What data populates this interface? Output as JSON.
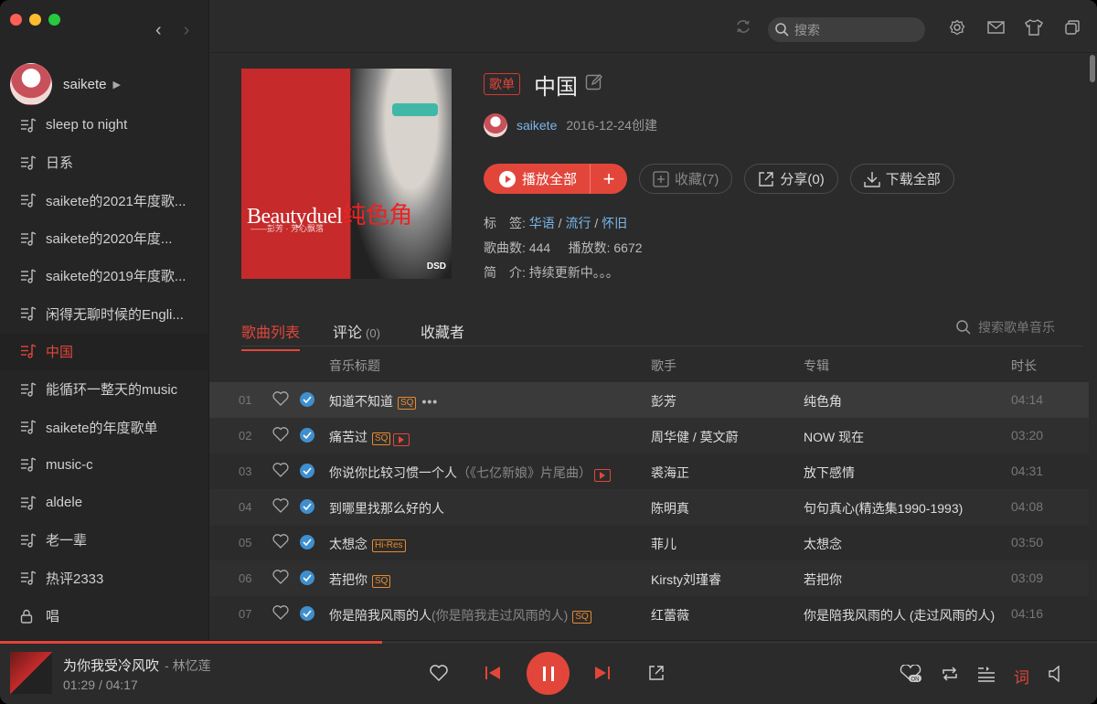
{
  "colors": {
    "accent": "#e2463b",
    "link": "#7ab6e8",
    "badge_orange": "#e58a30"
  },
  "topbar": {
    "search_placeholder": "搜索"
  },
  "sidebar": {
    "user": "saikete",
    "playlists": [
      {
        "label": "sleep to night",
        "icon": "playlist-icon"
      },
      {
        "label": "日系",
        "icon": "playlist-icon"
      },
      {
        "label": "saikete的2021年度歌...",
        "icon": "playlist-icon"
      },
      {
        "label": "saikete的2020年度...",
        "icon": "playlist-icon"
      },
      {
        "label": "saikete的2019年度歌...",
        "icon": "playlist-icon"
      },
      {
        "label": "闲得无聊时候的Engli...",
        "icon": "playlist-icon"
      },
      {
        "label": "中国",
        "icon": "playlist-icon",
        "active": true
      },
      {
        "label": "能循环一整天的music",
        "icon": "playlist-icon"
      },
      {
        "label": "saikete的年度歌单",
        "icon": "playlist-icon"
      },
      {
        "label": "music-c",
        "icon": "playlist-icon"
      },
      {
        "label": "aldele",
        "icon": "playlist-icon"
      },
      {
        "label": "老一辈",
        "icon": "playlist-icon"
      },
      {
        "label": "热评2333",
        "icon": "playlist-icon"
      },
      {
        "label": "唱",
        "icon": "lock-icon"
      }
    ]
  },
  "cover": {
    "title_en": "Beautyduel",
    "title_cn": "纯色角",
    "subtitle": "——彭芳 · 芳心飘落",
    "label": "DSD"
  },
  "playlist": {
    "tag": "歌单",
    "title": "中国",
    "creator": "saikete",
    "created": "2016-12-24创建",
    "buttons": {
      "play_all": "播放全部",
      "collect": "收藏(7)",
      "share": "分享(0)",
      "download": "下载全部"
    },
    "tags_label": "标　签:",
    "tags": [
      "华语",
      "流行",
      "怀旧"
    ],
    "song_count_label": "歌曲数:",
    "song_count": "444",
    "play_count_label": "播放数:",
    "play_count": "6672",
    "desc_label": "简　介:",
    "desc": "持续更新中。。。"
  },
  "tabs": {
    "songs": "歌曲列表",
    "comments": "评论",
    "comments_count": "(0)",
    "collectors": "收藏者",
    "search_placeholder": "搜索歌单音乐"
  },
  "columns": {
    "title": "音乐标题",
    "artist": "歌手",
    "album": "专辑",
    "duration": "时长"
  },
  "songs": [
    {
      "num": "01",
      "title": "知道不知道",
      "sub": "",
      "badges": [
        "SQ"
      ],
      "mv": false,
      "more": true,
      "artist": "彭芳",
      "album": "纯色角",
      "duration": "04:14"
    },
    {
      "num": "02",
      "title": "痛苦过",
      "sub": "",
      "badges": [
        "SQ"
      ],
      "mv": true,
      "artist": "周华健 / 莫文蔚",
      "album": "NOW 现在",
      "duration": "03:20"
    },
    {
      "num": "03",
      "title": "你说你比较习惯一个人",
      "sub": "（《七亿新娘》片尾曲）",
      "badges": [],
      "mv": true,
      "artist": "裘海正",
      "album": "放下感情",
      "duration": "04:31"
    },
    {
      "num": "04",
      "title": "到哪里找那么好的人",
      "sub": "",
      "badges": [],
      "mv": false,
      "artist": "陈明真",
      "album": "句句真心(精选集1990-1993)",
      "duration": "04:08"
    },
    {
      "num": "05",
      "title": "太想念",
      "sub": "",
      "badges": [
        "Hi-Res"
      ],
      "mv": false,
      "artist": "菲儿",
      "album": "太想念",
      "duration": "03:50"
    },
    {
      "num": "06",
      "title": "若把你",
      "sub": "",
      "badges": [
        "SQ"
      ],
      "mv": false,
      "artist": "Kirsty刘瑾睿",
      "album": "若把你",
      "duration": "03:09"
    },
    {
      "num": "07",
      "title": "你是陪我风雨的人",
      "sub": "(你是陪我走过风雨的人)",
      "badges": [
        "SQ"
      ],
      "mv": false,
      "artist": "红蕾薇",
      "album": "你是陪我风雨的人 (走过风雨的人)",
      "duration": "04:16"
    }
  ],
  "player": {
    "title": "为你我受冷风吹",
    "artist": "- 林忆莲",
    "current": "01:29",
    "total": "04:17",
    "time_sep": "/",
    "progress": 0.348,
    "lyric_label": "词"
  }
}
